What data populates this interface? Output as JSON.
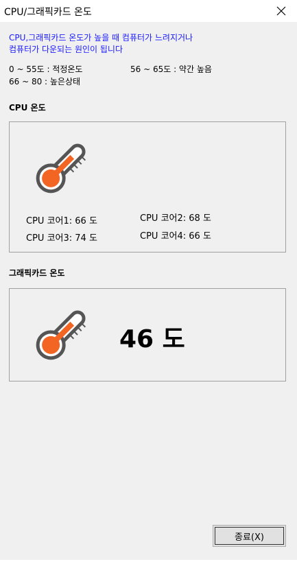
{
  "window": {
    "title": "CPU/그래픽카드 온도"
  },
  "info": {
    "line1": "CPU,그래픽카드 온도가 높을 때 컴퓨터가 느려지거나",
    "line2": "컴퓨터가 다운되는 원인이 됩니다",
    "range_normal": "0  ~ 55도 : 적정온도",
    "range_slightly_high": "56 ~ 65도 : 약간 높음",
    "range_high": "66 ~ 80 : 높은상태"
  },
  "cpu": {
    "section_label": "CPU 온도",
    "cores": [
      {
        "label": "CPU 코어1: 66 도"
      },
      {
        "label": "CPU 코어2: 68 도"
      },
      {
        "label": "CPU 코어3: 74 도"
      },
      {
        "label": "CPU 코어4: 66 도"
      }
    ]
  },
  "gpu": {
    "section_label": "그래픽카드 온도",
    "temperature_text": "46 도"
  },
  "buttons": {
    "close_label": "종료(X)"
  },
  "colors": {
    "thermometer_fill": "#f26522",
    "thermometer_outline": "#555555",
    "info_text": "#1a1aff"
  },
  "icons": {
    "close": "close-icon",
    "thermometer": "thermometer-icon"
  }
}
